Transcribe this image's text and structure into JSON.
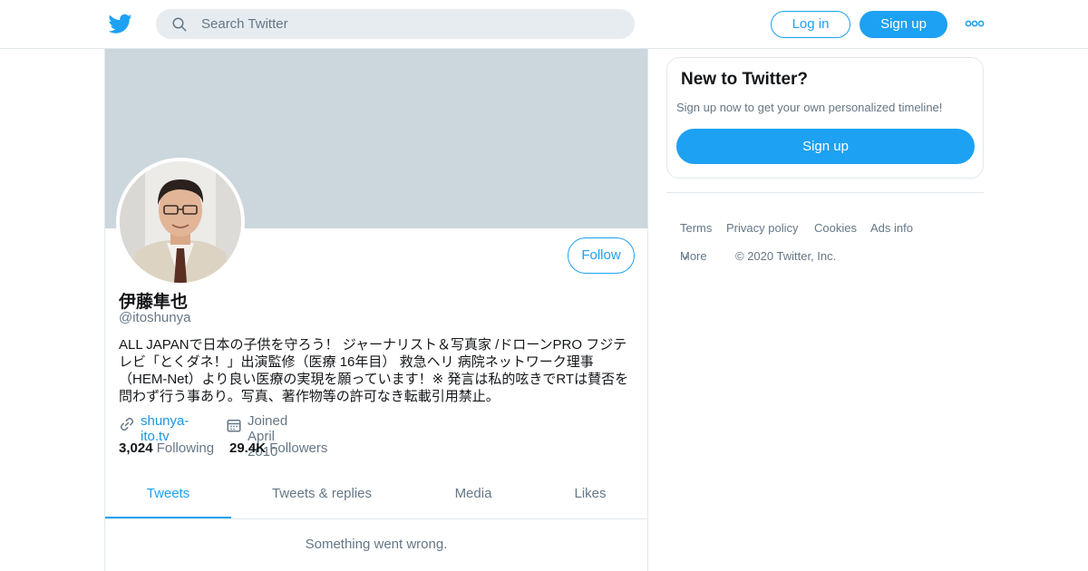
{
  "topbar": {
    "search_placeholder": "Search Twitter",
    "login_label": "Log in",
    "signup_label": "Sign up",
    "brand_color": "#1da1f2"
  },
  "profile": {
    "display_name": "伊藤隼也",
    "handle": "@itoshunya",
    "follow_label": "Follow",
    "bio_lines": [
      "ALL JAPANで日本の子供を守ろう！ ジャーナリスト＆写真家 /ドローンPRO フジテ",
      "レビ「とくダネ！」出演監修（医療 16年目） 救急ヘリ 病院ネットワーク理事",
      "（HEM-Net）より良い医療の実現を願っています！※ 発言は私的呟きでRTは賛否を",
      "問わず行う事あり。写真、著作物等の許可なき転載引用禁止。"
    ],
    "website": "shunya-ito.tv",
    "joined": "Joined April 2010",
    "following_count": "3,024",
    "following_label": "Following",
    "followers_count": "29.4K",
    "followers_label": "Followers"
  },
  "tabs": [
    {
      "label": "Tweets",
      "active": true
    },
    {
      "label": "Tweets & replies",
      "active": false
    },
    {
      "label": "Media",
      "active": false
    },
    {
      "label": "Likes",
      "active": false
    }
  ],
  "timeline": {
    "error_message": "Something went wrong."
  },
  "sidebar": {
    "card_title": "New to Twitter?",
    "card_subtitle": "Sign up now to get your own personalized timeline!",
    "card_button": "Sign up",
    "footer_links": [
      "Terms",
      "Privacy policy",
      "Cookies",
      "Ads info"
    ],
    "footer_more": "More",
    "copyright": "© 2020 Twitter, Inc."
  }
}
